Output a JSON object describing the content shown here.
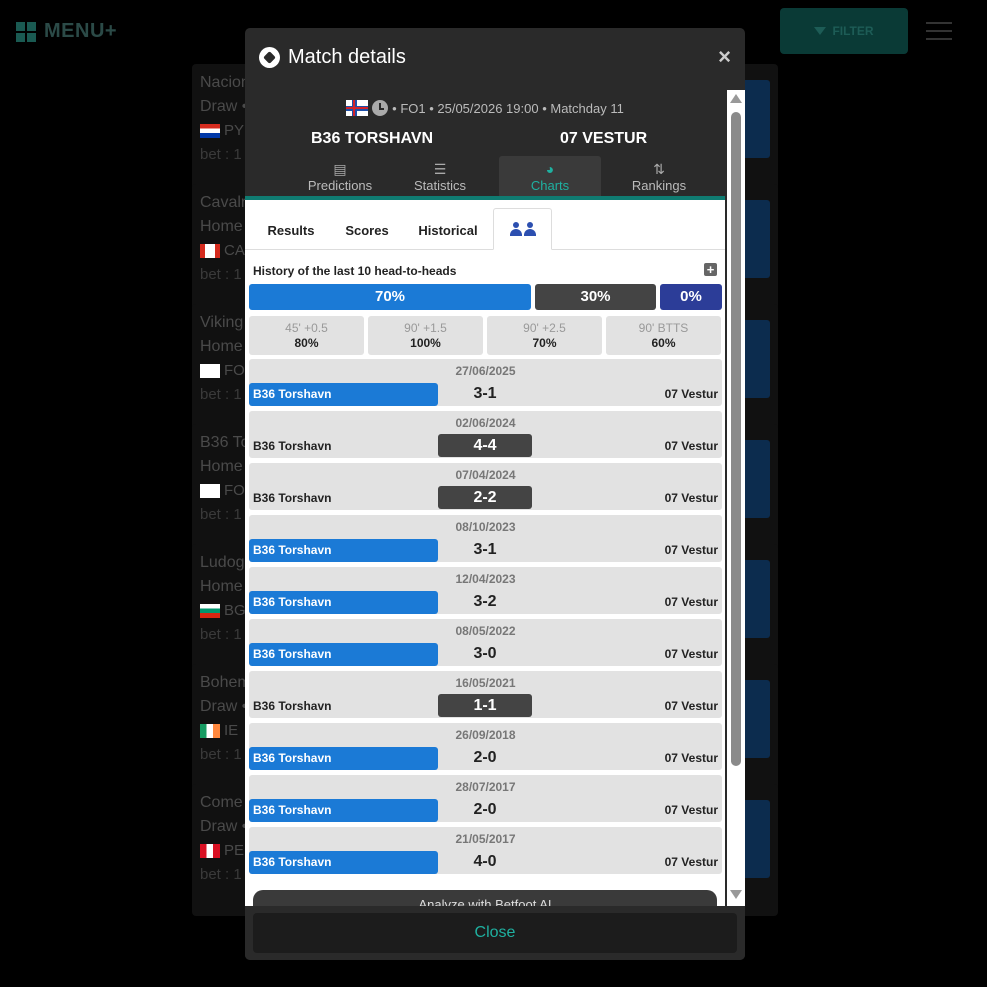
{
  "app": {
    "menu_label": "MENU+",
    "filter_label": "FILTER"
  },
  "background_cards": [
    {
      "title": "Nacion",
      "sub": "Draw •",
      "code": "PY",
      "bet": "bet : 1"
    },
    {
      "title": "Cavalr",
      "sub": "Home",
      "code": "CA",
      "bet": "bet : 1"
    },
    {
      "title": "Viking",
      "sub": "Home",
      "code": "FO",
      "bet": "bet : 1"
    },
    {
      "title": "B36 To",
      "sub": "Home",
      "code": "FO",
      "bet": "bet : 1"
    },
    {
      "title": "Ludog",
      "sub": "Home",
      "code": "BG",
      "bet": "bet : 1"
    },
    {
      "title": "Bohem",
      "sub": "Draw •",
      "code": "IE",
      "bet": "bet : 1"
    },
    {
      "title": "Come",
      "sub": "Draw •",
      "code": "PE",
      "bet": "bet : 1"
    }
  ],
  "modal": {
    "title": "Match details",
    "close_glyph": "×",
    "match_meta": "• FO1 • 25/05/2026 19:00 • Matchday 11",
    "home_team": "B36 TORSHAVN",
    "away_team": "07 VESTUR",
    "main_tabs": [
      {
        "label": "Predictions",
        "icon": "predictions-icon"
      },
      {
        "label": "Statistics",
        "icon": "sliders-icon"
      },
      {
        "label": "Charts",
        "icon": "pie-chart-icon",
        "active": true
      },
      {
        "label": "Rankings",
        "icon": "sort-icon"
      }
    ],
    "sub_tabs": [
      {
        "label": "Results"
      },
      {
        "label": "Scores"
      },
      {
        "label": "Historical"
      },
      {
        "label": "",
        "icon": "people-icon",
        "active": true
      }
    ],
    "h2h": {
      "title": "History of the last 10 head-to-heads",
      "home_pct": "70%",
      "draw_pct": "30%",
      "away_pct": "0%",
      "stats": [
        {
          "label": "45' +0.5",
          "value": "80%"
        },
        {
          "label": "90' +1.5",
          "value": "100%"
        },
        {
          "label": "90' +2.5",
          "value": "70%"
        },
        {
          "label": "90' BTTS",
          "value": "60%"
        }
      ],
      "matches": [
        {
          "date": "27/06/2025",
          "home": "B36 Torshavn",
          "score": "3-1",
          "away": "07 Vestur",
          "result": "win"
        },
        {
          "date": "02/06/2024",
          "home": "B36 Torshavn",
          "score": "4-4",
          "away": "07 Vestur",
          "result": "draw"
        },
        {
          "date": "07/04/2024",
          "home": "B36 Torshavn",
          "score": "2-2",
          "away": "07 Vestur",
          "result": "draw"
        },
        {
          "date": "08/10/2023",
          "home": "B36 Torshavn",
          "score": "3-1",
          "away": "07 Vestur",
          "result": "win"
        },
        {
          "date": "12/04/2023",
          "home": "B36 Torshavn",
          "score": "3-2",
          "away": "07 Vestur",
          "result": "win"
        },
        {
          "date": "08/05/2022",
          "home": "B36 Torshavn",
          "score": "3-0",
          "away": "07 Vestur",
          "result": "win"
        },
        {
          "date": "16/05/2021",
          "home": "B36 Torshavn",
          "score": "1-1",
          "away": "07 Vestur",
          "result": "draw"
        },
        {
          "date": "26/09/2018",
          "home": "B36 Torshavn",
          "score": "2-0",
          "away": "07 Vestur",
          "result": "win"
        },
        {
          "date": "28/07/2017",
          "home": "B36 Torshavn",
          "score": "2-0",
          "away": "07 Vestur",
          "result": "win"
        },
        {
          "date": "21/05/2017",
          "home": "B36 Torshavn",
          "score": "4-0",
          "away": "07 Vestur",
          "result": "win"
        }
      ]
    },
    "analyze_label": "Analyze with Betfoot AI",
    "close_button": "Close"
  },
  "colors": {
    "accent": "#1fb0a0",
    "home_win": "#1b7ad6",
    "draw": "#444444",
    "away": "#2c3d98"
  }
}
